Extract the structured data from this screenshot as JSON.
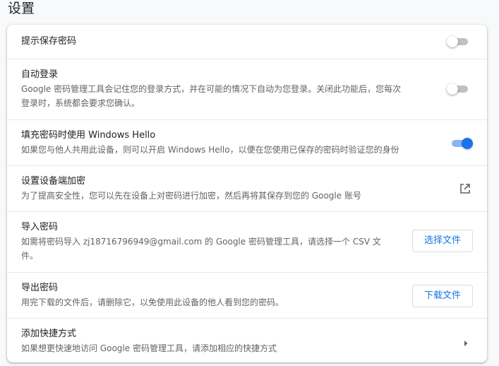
{
  "page": {
    "title": "设置"
  },
  "rows": [
    {
      "label": "提示保存密码",
      "toggle": "off"
    },
    {
      "label": "自动登录",
      "desc_line1": "Google 密码管理工具会记住您的登录方式，并在可能的情况下自动为您登录。关闭此功能后，您每次",
      "desc_line2": "登录时，系统都会要求您确认。",
      "toggle": "off"
    },
    {
      "label": "填充密码时使用 Windows Hello",
      "desc": "如果您与他人共用此设备，则可以开启 Windows Hello，以便在您使用已保存的密码时验证您的身份",
      "toggle": "on"
    },
    {
      "label": "设置设备端加密",
      "desc": "为了提高安全性，您可以先在设备上对密码进行加密，然后再将其保存到您的 Google 账号",
      "icon": "open-in-new-icon"
    },
    {
      "label": "导入密码",
      "desc_line1": "如需将密码导入 zj18716796949@gmail.com 的 Google 密码管理工具，请选择一个 CSV 文",
      "desc_line2": "件。",
      "button": "选择文件"
    },
    {
      "label": "导出密码",
      "desc": "用完下载的文件后，请删除它，以免使用此设备的他人看到您的密码。",
      "button": "下载文件"
    },
    {
      "label": "添加快捷方式",
      "desc": "如果想更快速地访问 Google 密码管理工具，请添加相应的快捷方式",
      "icon": "chevron-right-icon"
    }
  ],
  "colors": {
    "accent": "#1a73e8",
    "toggle_on_track": "#8ab4f8",
    "toggle_off_track": "#bdc1c6"
  }
}
